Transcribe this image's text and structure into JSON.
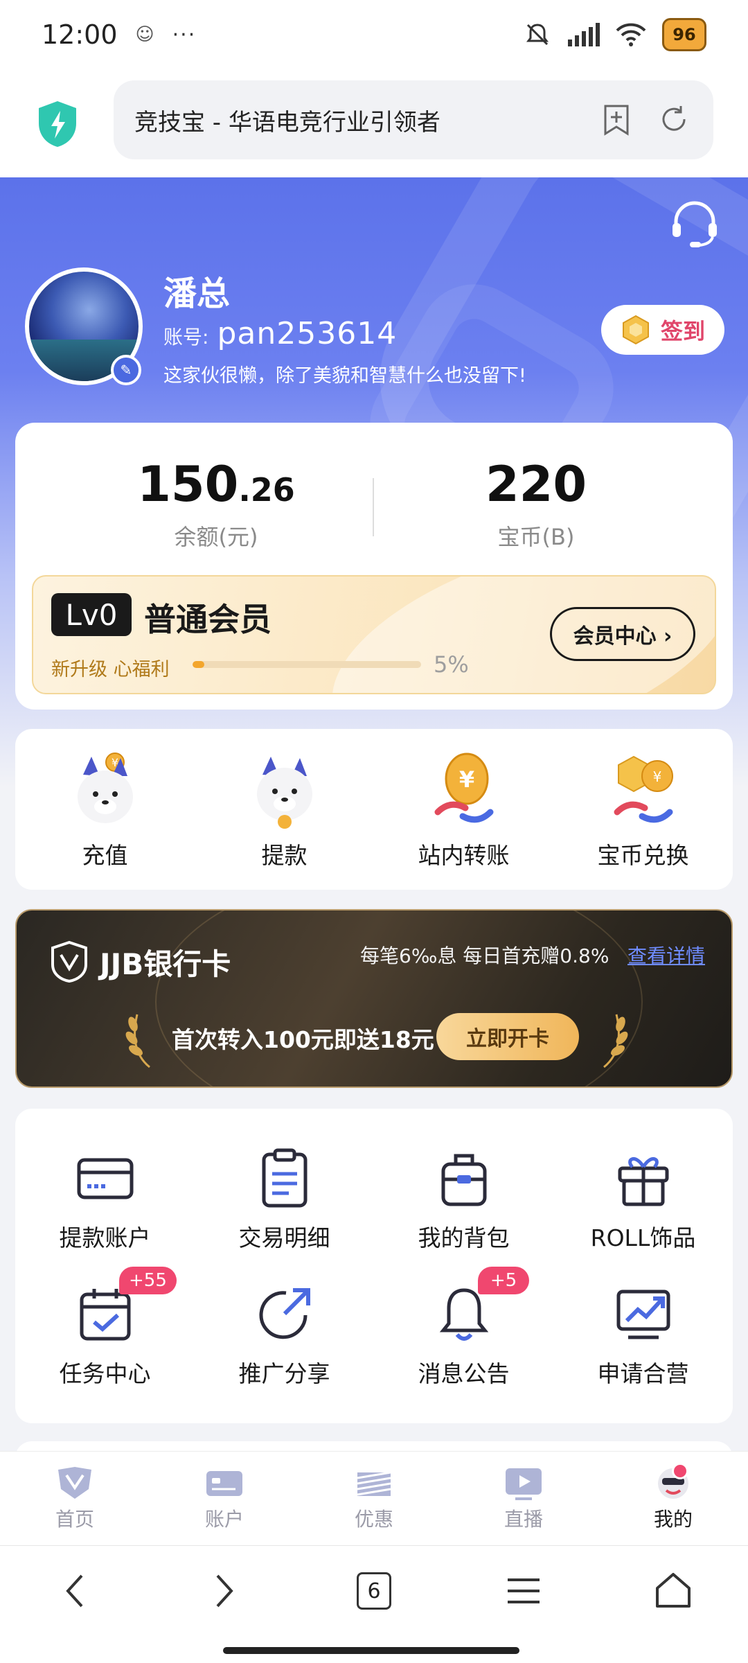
{
  "status_bar": {
    "time": "12:00",
    "battery": "96"
  },
  "browser": {
    "page_title": "竞技宝 - 华语电竞行业引领者",
    "tab_count": "6"
  },
  "profile": {
    "name": "潘总",
    "account_label": "账号:",
    "account_value": "pan253614",
    "bio": "这家伙很懒，除了美貌和智慧什么也没留下!",
    "checkin_label": "签到"
  },
  "balance": {
    "amount_int": "150",
    "amount_dec": ".26",
    "amount_label": "余额(元)",
    "coins": "220",
    "coins_label": "宝币(B)"
  },
  "membership": {
    "level": "Lv0",
    "title": "普通会员",
    "subtitle": "新升级 心福利",
    "progress": 0.05,
    "progress_text": "5%",
    "button": "会员中心 ›"
  },
  "quick_actions": [
    {
      "label": "充值",
      "icon": "dog-mascot-coin-icon"
    },
    {
      "label": "提款",
      "icon": "dog-mascot-icon"
    },
    {
      "label": "站内转账",
      "icon": "yuan-coin-transfer-icon"
    },
    {
      "label": "宝币兑换",
      "icon": "coin-exchange-icon"
    }
  ],
  "bank_card": {
    "title": "JJB银行卡",
    "promo": "每笔6‰息 每日首充赠0.8%",
    "link": "查看详情",
    "offer": "首次转入100元即送18元",
    "button": "立即开卡"
  },
  "services": [
    {
      "label": "提款账户",
      "icon": "card-icon"
    },
    {
      "label": "交易明细",
      "icon": "clipboard-icon"
    },
    {
      "label": "我的背包",
      "icon": "backpack-icon"
    },
    {
      "label": "ROLL饰品",
      "icon": "gift-icon"
    },
    {
      "label": "任务中心",
      "icon": "calendar-check-icon",
      "badge": "+55"
    },
    {
      "label": "推广分享",
      "icon": "share-arrow-icon"
    },
    {
      "label": "消息公告",
      "icon": "bell-icon",
      "badge": "+5"
    },
    {
      "label": "申请合营",
      "icon": "trend-chart-icon"
    }
  ],
  "tabs": [
    {
      "label": "首页",
      "icon": "home-logo-icon"
    },
    {
      "label": "账户",
      "icon": "account-card-icon"
    },
    {
      "label": "优惠",
      "icon": "promo-icon"
    },
    {
      "label": "直播",
      "icon": "live-play-icon"
    },
    {
      "label": "我的",
      "icon": "my-avatar-icon",
      "active": true
    }
  ],
  "colors": {
    "accent": "#5c72ea",
    "badge": "#f0476f",
    "gold": "#f3a62c"
  }
}
